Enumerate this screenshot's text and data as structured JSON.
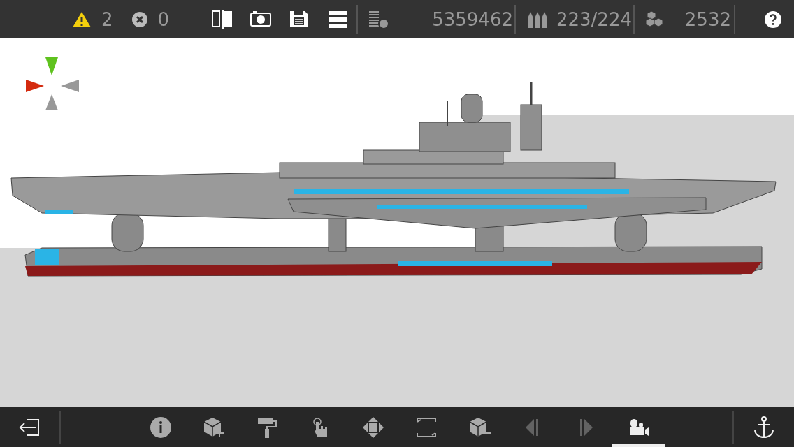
{
  "top_bar": {
    "warning_count": "2",
    "error_count": "0",
    "tools": [
      {
        "kind": "mirror"
      },
      {
        "kind": "camera"
      },
      {
        "kind": "save"
      },
      {
        "kind": "menu"
      }
    ],
    "stats": [
      {
        "kind": "cost",
        "value": "5359462"
      },
      {
        "kind": "ammo",
        "value": "223/224"
      },
      {
        "kind": "parts",
        "value": "2532"
      }
    ]
  },
  "bottom_bar": {
    "tools": [
      {
        "kind": "info",
        "selected": false,
        "disabled": false
      },
      {
        "kind": "add-block",
        "selected": false,
        "disabled": false
      },
      {
        "kind": "paint",
        "selected": false,
        "disabled": false
      },
      {
        "kind": "touch",
        "selected": false,
        "disabled": false
      },
      {
        "kind": "move",
        "selected": false,
        "disabled": false
      },
      {
        "kind": "rotate",
        "selected": false,
        "disabled": false
      },
      {
        "kind": "remove-block",
        "selected": false,
        "disabled": false
      },
      {
        "kind": "prev",
        "selected": false,
        "disabled": true
      },
      {
        "kind": "next",
        "selected": false,
        "disabled": true
      },
      {
        "kind": "camera",
        "selected": true,
        "disabled": false
      }
    ]
  }
}
